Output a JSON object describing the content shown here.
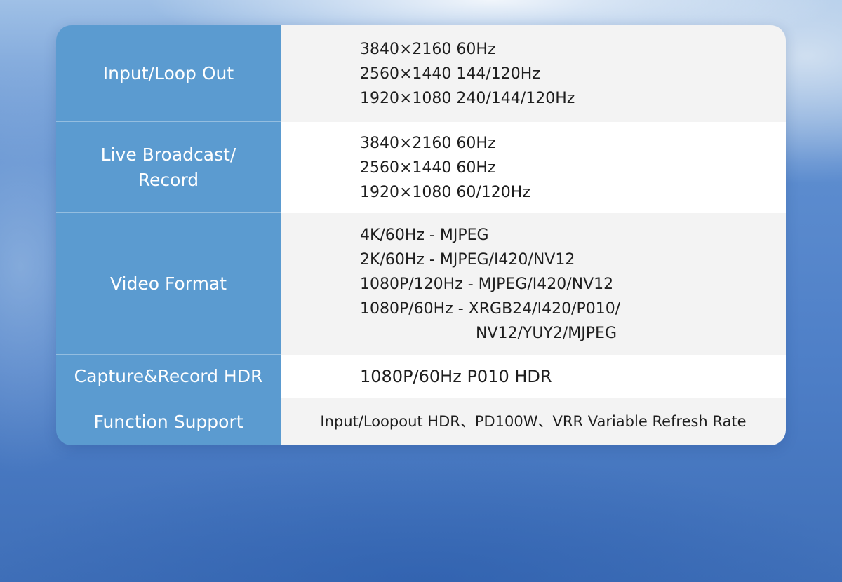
{
  "specs": {
    "input_loop_out": {
      "label": "Input/Loop Out",
      "values": [
        "3840×2160 60Hz",
        "2560×1440 144/120Hz",
        "1920×1080 240/144/120Hz"
      ]
    },
    "live_broadcast": {
      "label_line1": "Live Broadcast/",
      "label_line2": "Record",
      "values": [
        "3840×2160 60Hz",
        "2560×1440 60Hz",
        "1920×1080 60/120Hz"
      ]
    },
    "video_format": {
      "label": "Video Format",
      "values": [
        "4K/60Hz - MJPEG",
        "2K/60Hz - MJPEG/I420/NV12",
        "1080P/120Hz - MJPEG/I420/NV12",
        "1080P/60Hz - XRGB24/I420/P010/",
        "NV12/YUY2/MJPEG"
      ]
    },
    "capture_hdr": {
      "label": "Capture&Record HDR",
      "value": "1080P/60Hz P010 HDR"
    },
    "function_support": {
      "label": "Function Support",
      "value": "Input/Loopout HDR、PD100W、VRR Variable Refresh Rate"
    }
  }
}
